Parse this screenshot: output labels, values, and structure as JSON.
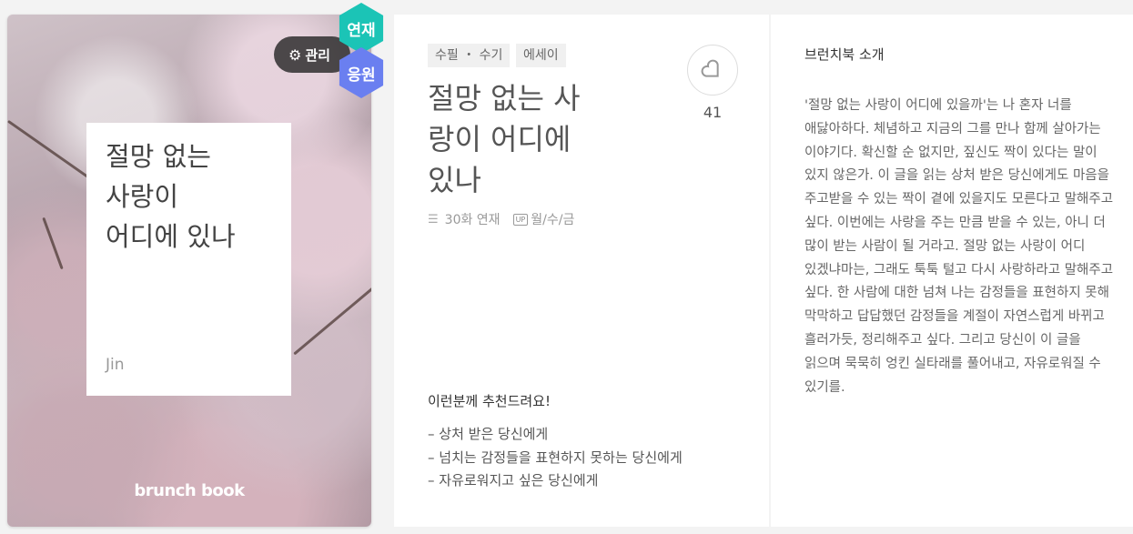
{
  "cover": {
    "title": "절망 없는\n사랑이\n어디에 있나",
    "author": "Jin",
    "brand": "brunch book",
    "manage_label": "관리",
    "serial_badge": "연재",
    "support_badge": "응원"
  },
  "book": {
    "tags": [
      "수필 ・ 수기",
      "에세이"
    ],
    "title": "절망 없는 사랑이 어디에 있나",
    "episodes": "30화 연재",
    "schedule": "월/수/금",
    "schedule_icon": "UP",
    "like_count": "41"
  },
  "recommend": {
    "title": "이런분께 추천드려요!",
    "items": [
      "상처 받은 당신에게",
      "넘치는 감정들을 표현하지 못하는 당신에게",
      "자유로워지고 싶은 당신에게"
    ]
  },
  "intro": {
    "title": "브런치북 소개",
    "body": "'절망 없는 사랑이 어디에 있을까'는 나 혼자 너를 애닳아하다. 체념하고 지금의 그를 만나 함께 살아가는 이야기다. 확신할 순 없지만, 짚신도 짝이 있다는 말이 있지 않은가. 이 글을 읽는 상처 받은 당신에게도 마음을 주고받을 수 있는 짝이 곁에 있을지도 모른다고 말해주고 싶다. 이번에는 사랑을 주는 만큼 받을 수 있는, 아니 더 많이 받는 사람이 될 거라고. 절망 없는 사랑이 어디 있겠냐마는, 그래도 툭툭 털고 다시 사랑하라고 말해주고 싶다. 한 사람에 대한 넘쳐 나는 감정들을 표현하지 못해 막막하고 답답했던 감정들을 계절이 자연스럽게 바뀌고 흘러가듯, 정리해주고 싶다. 그리고 당신이 이 글을 읽으며 묵묵히 엉킨 실타래를 풀어내고, 자유로워질 수 있기를."
  },
  "colors": {
    "serial": "#1bc4b6",
    "support": "#6a7ff0"
  }
}
